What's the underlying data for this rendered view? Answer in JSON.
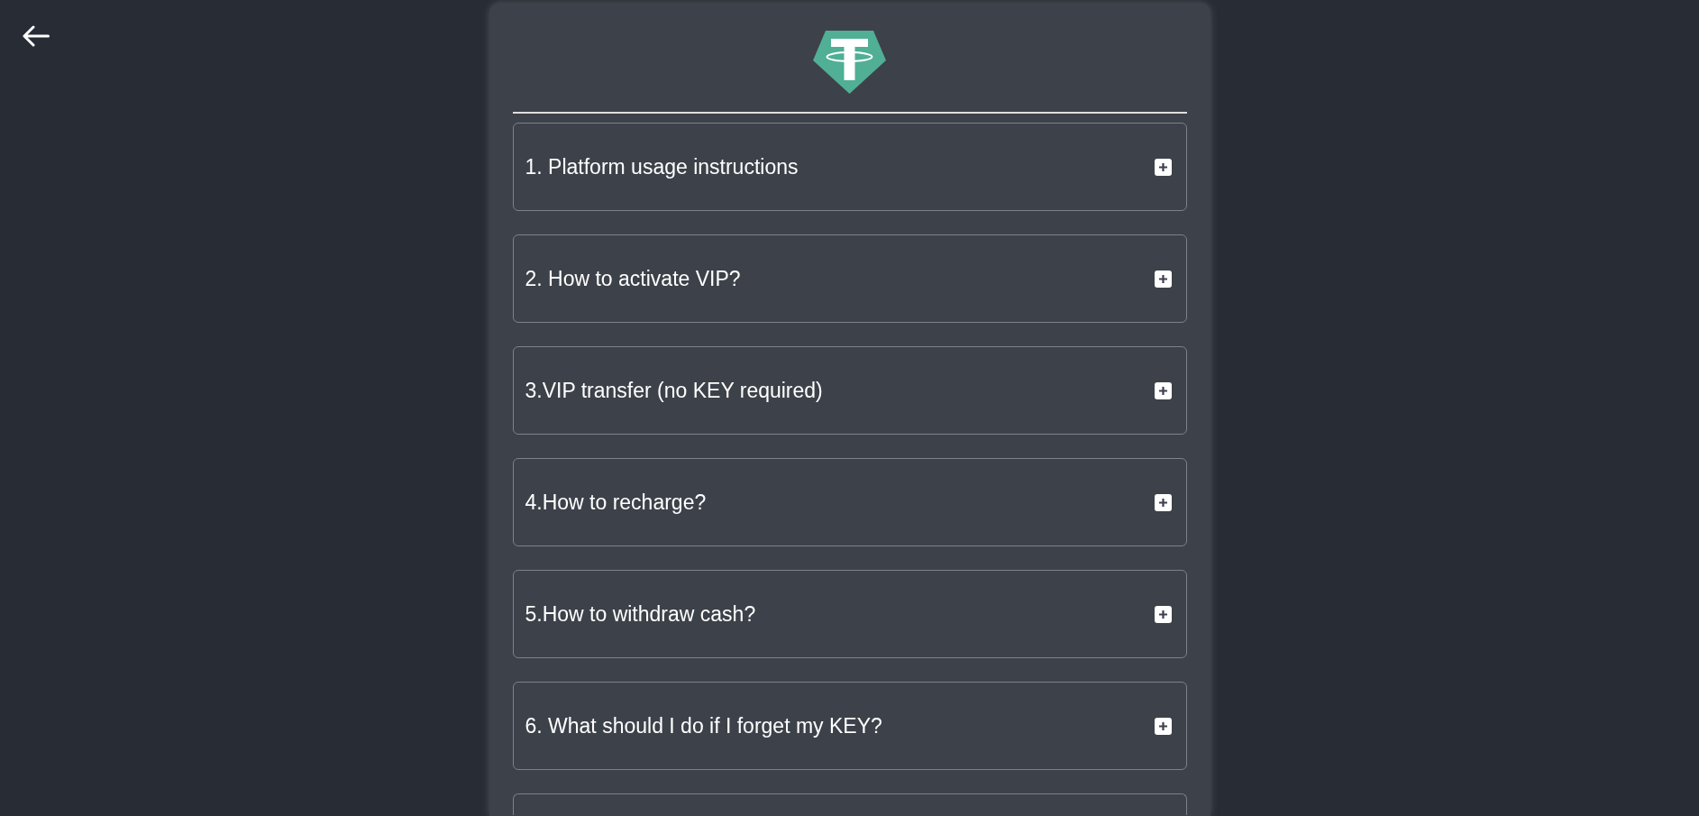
{
  "faq": {
    "items": [
      {
        "title": "1. Platform usage instructions",
        "expanded": false
      },
      {
        "title": "2. How to activate VIP?",
        "expanded": false
      },
      {
        "title": "3.VIP transfer (no KEY required)",
        "expanded": false
      },
      {
        "title": "4.How to recharge?",
        "expanded": false
      },
      {
        "title": "5.How to withdraw cash?",
        "expanded": false
      },
      {
        "title": "6. What should I do if I forget my KEY?",
        "expanded": false
      }
    ],
    "next_item_peeking": true
  }
}
